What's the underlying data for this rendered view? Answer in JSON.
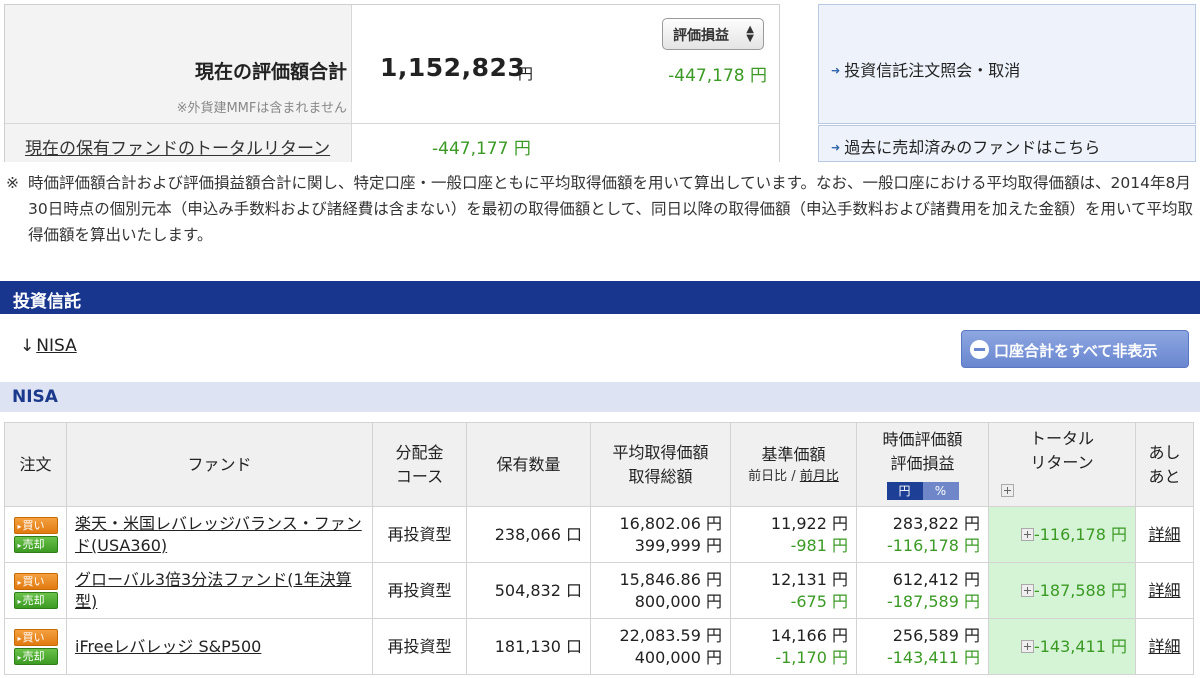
{
  "summary": {
    "total_label": "現在の評価額合計",
    "total_value": "1,152,823",
    "currency": "円",
    "mmf_note": "※外貨建MMFは含まれません",
    "selector_value": "評価損益",
    "pl_value": "-447,178 円",
    "total_return_label": "現在の保有ファンドのトータルリターン",
    "total_return_value": "-447,177 円"
  },
  "side_links": {
    "order_inquiry": "投資信託注文照会・取消",
    "sold_funds": "過去に売却済みのファンドはこちら"
  },
  "note": {
    "mark": "※",
    "text": "時価評価額合計および評価損益額合計に関し、特定口座・一般口座ともに平均取得価額を用いて算出しています。なお、一般口座における平均取得価額は、2014年8月30日時点の個別元本（申込み手数料および諸経費は含まない）を最初の取得価額として、同日以降の取得価額（申込手数料および諸費用を加えた金額）を用いて平均取得価額を算出いたします。"
  },
  "section": {
    "title": "投資信託",
    "jump_arrow": "↓",
    "jump_link": "NISA",
    "hide_all_button": "口座合計をすべて非表示",
    "account_label": "NISA"
  },
  "table": {
    "headers": {
      "order": "注文",
      "fund": "ファンド",
      "course_1": "分配金",
      "course_2": "コース",
      "qty": "保有数量",
      "avg_1": "平均取得価額",
      "avg_2": "取得総額",
      "base_1": "基準価額",
      "base_sub_a": "前日比",
      "base_sub_sep": "/",
      "base_sub_b": "前月比",
      "eval_1": "時価評価額",
      "eval_2": "評価損益",
      "toggle_yen": "円",
      "toggle_pct": "%",
      "total_1": "トータル",
      "total_2": "リターン",
      "detail_1": "あし",
      "detail_2": "あと"
    },
    "buy_label": "買い",
    "sell_label": "売却",
    "detail_link": "詳細",
    "rows": [
      {
        "fund": "楽天・米国レバレッジバランス・ファンド(USA360)",
        "course": "再投資型",
        "qty": "238,066 口",
        "avg_price": "16,802.06 円",
        "acq_total": "399,999 円",
        "base_price": "11,922 円",
        "base_change": "-981 円",
        "eval_value": "283,822 円",
        "eval_pl": "-116,178 円",
        "total_return": "-116,178 円"
      },
      {
        "fund": "グローバル3倍3分法ファンド(1年決算型)",
        "course": "再投資型",
        "qty": "504,832 口",
        "avg_price": "15,846.86 円",
        "acq_total": "800,000 円",
        "base_price": "12,131 円",
        "base_change": "-675 円",
        "eval_value": "612,412 円",
        "eval_pl": "-187,589 円",
        "total_return": "-187,588 円"
      },
      {
        "fund": "iFreeレバレッジ S&P500",
        "course": "再投資型",
        "qty": "181,130 口",
        "avg_price": "22,083.59 円",
        "acq_total": "400,000 円",
        "base_price": "14,166 円",
        "base_change": "-1,170 円",
        "eval_value": "256,589 円",
        "eval_pl": "-143,411 円",
        "total_return": "-143,411 円"
      }
    ]
  }
}
